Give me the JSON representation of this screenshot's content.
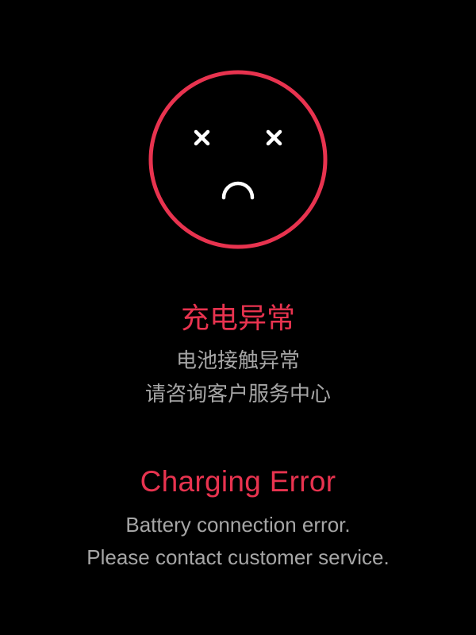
{
  "colors": {
    "background": "#000000",
    "accent": "#e8334f",
    "message_text": "#a6a6a6",
    "icon_features": "#ffffff"
  },
  "icon": "sad-face-error-icon",
  "chinese": {
    "title": "充电异常",
    "line1": "电池接触异常",
    "line2": "请咨询客户服务中心"
  },
  "english": {
    "title": "Charging Error",
    "line1": "Battery connection error.",
    "line2": "Please contact customer service."
  }
}
